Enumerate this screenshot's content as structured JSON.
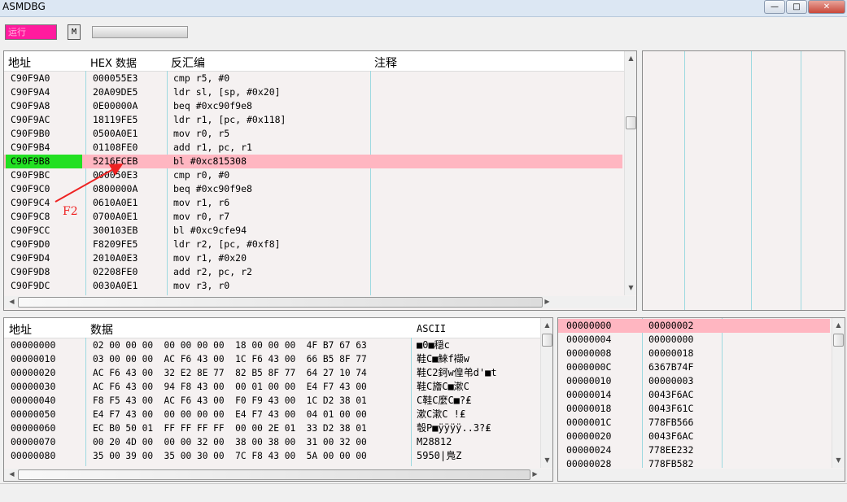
{
  "window": {
    "title": "ASMDBG",
    "controls": [
      "—",
      "□",
      "✕"
    ]
  },
  "toolbar": {
    "status_text": "运行",
    "m_label": "M"
  },
  "colors": {
    "highlight_row": "#ffb6c1",
    "current_address": "#22e022",
    "status_field": "#ff1b9e",
    "annotation": "#e02020"
  },
  "disasm": {
    "headers": {
      "address": "地址",
      "hex": "HEX 数据",
      "asm": "反汇编",
      "comment": "注释"
    },
    "highlighted_index": 6,
    "rows": [
      {
        "address": "C90F9A0",
        "hex": "000055E3",
        "asm": "cmp r5, #0"
      },
      {
        "address": "C90F9A4",
        "hex": "20A09DE5",
        "asm": "ldr sl, [sp, #0x20]"
      },
      {
        "address": "C90F9A8",
        "hex": "0E00000A",
        "asm": "beq #0xc90f9e8"
      },
      {
        "address": "C90F9AC",
        "hex": "18119FE5",
        "asm": "ldr r1, [pc, #0x118]"
      },
      {
        "address": "C90F9B0",
        "hex": "0500A0E1",
        "asm": "mov r0, r5"
      },
      {
        "address": "C90F9B4",
        "hex": "01108FE0",
        "asm": "add r1, pc, r1"
      },
      {
        "address": "C90F9B8",
        "hex": "5216FCEB",
        "asm": "bl #0xc815308"
      },
      {
        "address": "C90F9BC",
        "hex": "000050E3",
        "asm": "cmp r0, #0"
      },
      {
        "address": "C90F9C0",
        "hex": "0800000A",
        "asm": "beq #0xc90f9e8"
      },
      {
        "address": "C90F9C4",
        "hex": "0610A0E1",
        "asm": "mov r1, r6"
      },
      {
        "address": "C90F9C8",
        "hex": "0700A0E1",
        "asm": "mov r0, r7"
      },
      {
        "address": "C90F9CC",
        "hex": "300103EB",
        "asm": "bl #0xc9cfe94"
      },
      {
        "address": "C90F9D0",
        "hex": "F8209FE5",
        "asm": "ldr r2, [pc, #0xf8]"
      },
      {
        "address": "C90F9D4",
        "hex": "2010A0E3",
        "asm": "mov r1, #0x20"
      },
      {
        "address": "C90F9D8",
        "hex": "02208FE0",
        "asm": "add r2, pc, r2"
      },
      {
        "address": "C90F9DC",
        "hex": "0030A0E1",
        "asm": "mov r3, r0"
      }
    ]
  },
  "annotation": {
    "label": "F2"
  },
  "memory": {
    "headers": {
      "address": "地址",
      "data": "数据",
      "ascii": "ASCII"
    },
    "rows": [
      {
        "address": "00000000",
        "bytes": "02 00 00 00  00 00 00 00  18 00 00 00  4F B7 67 63",
        "ascii": "■0■穏c"
      },
      {
        "address": "00000010",
        "bytes": "03 00 00 00  AC F6 43 00  1C F6 43 00  66 B5 8F 77",
        "ascii": " 鞋C■鯠f襭w"
      },
      {
        "address": "00000020",
        "bytes": "AC F6 43 00  32 E2 8E 77  82 B5 8F 77  64 27 10 74",
        "ascii": "鞋C2鈳w偟弚d'■t"
      },
      {
        "address": "00000030",
        "bytes": "AC F6 43 00  94 F8 43 00  00 01 00 00  E4 F7 43 00",
        "ascii": "鞋C旝C■漱C"
      },
      {
        "address": "00000040",
        "bytes": "F8 F5 43 00  AC F6 43 00  F0 F9 43 00  1C D2 38 01",
        "ascii": " C鞋C麼C■?₤"
      },
      {
        "address": "00000050",
        "bytes": "E4 F7 43 00  00 00 00 00  E4 F7 43 00  04 01 00 00",
        "ascii": "漱C漱C !₤"
      },
      {
        "address": "00000060",
        "bytes": "EC B0 50 01  FF FF FF FF  00 00 2E 01  33 D2 38 01",
        "ascii": "彀P■ÿÿÿÿ..3?₤"
      },
      {
        "address": "00000070",
        "bytes": "00 20 4D 00  00 00 32 00  38 00 38 00  31 00 32 00",
        "ascii": "M28812"
      },
      {
        "address": "00000080",
        "bytes": "35 00 39 00  35 00 30 00  7C F8 43 00  5A 00 00 00",
        "ascii": "5950|鳬Z"
      }
    ]
  },
  "stack": {
    "highlighted_index": 0,
    "rows": [
      {
        "offset": "00000000",
        "value": "00000002"
      },
      {
        "offset": "00000004",
        "value": "00000000"
      },
      {
        "offset": "00000008",
        "value": "00000018"
      },
      {
        "offset": "0000000C",
        "value": "6367B74F"
      },
      {
        "offset": "00000010",
        "value": "00000003"
      },
      {
        "offset": "00000014",
        "value": "0043F6AC"
      },
      {
        "offset": "00000018",
        "value": "0043F61C"
      },
      {
        "offset": "0000001C",
        "value": "778FB566"
      },
      {
        "offset": "00000020",
        "value": "0043F6AC"
      },
      {
        "offset": "00000024",
        "value": "778EE232"
      },
      {
        "offset": "00000028",
        "value": "778FB582"
      }
    ]
  },
  "icons": {
    "minimize": "minimize-icon",
    "maximize": "maximize-icon",
    "close": "close-icon",
    "scroll_up": "scroll-up-arrow-icon",
    "scroll_down": "scroll-down-arrow-icon",
    "scroll_left": "scroll-left-arrow-icon",
    "scroll_right": "scroll-right-arrow-icon"
  }
}
